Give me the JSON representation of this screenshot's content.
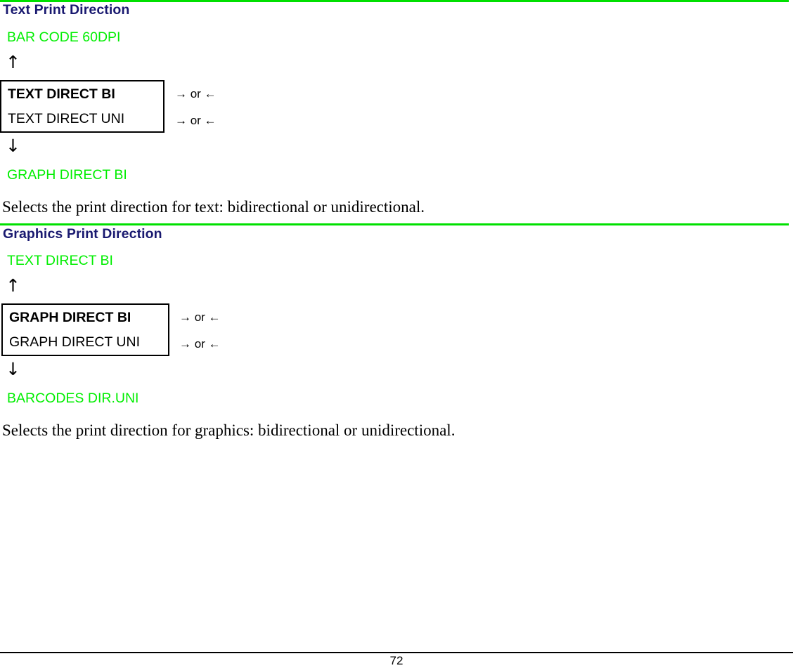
{
  "colors": {
    "heading": "#191970",
    "rule": "#00e000",
    "menu_label": "#00ee00",
    "text": "#000000"
  },
  "sections": [
    {
      "heading": "Text Print Direction",
      "prev_menu_label": "BAR CODE 60DPI",
      "up_arrow": "↑",
      "down_arrow": "↓",
      "next_menu_label": "GRAPH DIRECT BI",
      "options": [
        {
          "label": "TEXT DIRECT BI",
          "selected": true,
          "key_hint": "→ or ←"
        },
        {
          "label": "TEXT DIRECT UNI",
          "selected": false,
          "key_hint": "→ or ←"
        }
      ],
      "description": "Selects the print direction for text: bidirectional or unidirectional."
    },
    {
      "heading": "Graphics Print Direction",
      "prev_menu_label": "TEXT DIRECT BI",
      "up_arrow": "↑",
      "down_arrow": "↓",
      "next_menu_label": "BARCODES DIR.UNI",
      "options": [
        {
          "label": "GRAPH DIRECT BI",
          "selected": true,
          "key_hint": "→ or ←"
        },
        {
          "label": "GRAPH DIRECT UNI",
          "selected": false,
          "key_hint": "→ or ←"
        }
      ],
      "description": "Selects the print direction for graphics: bidirectional or unidirectional."
    }
  ],
  "footer": {
    "page_number": "72"
  }
}
